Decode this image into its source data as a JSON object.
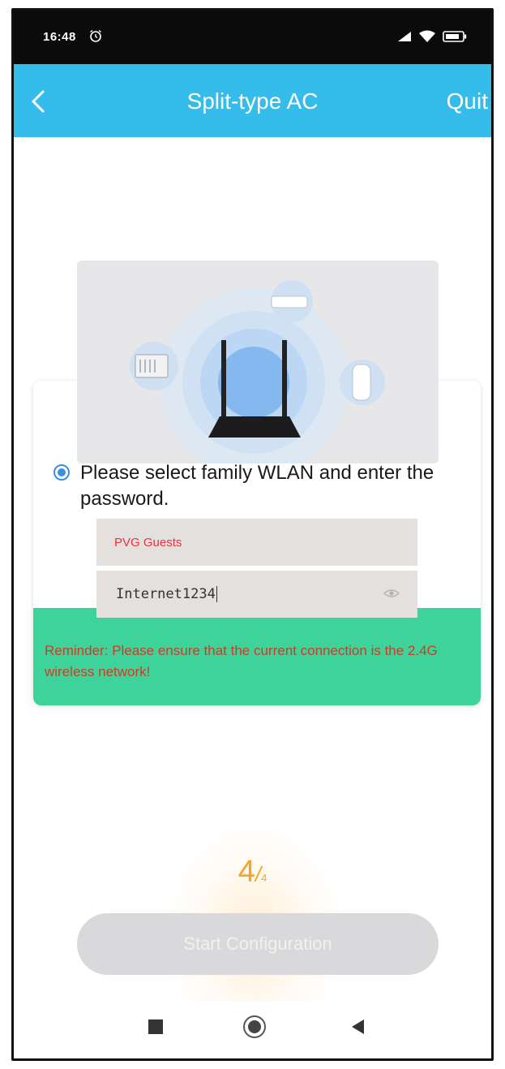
{
  "status_bar": {
    "time": "16:48",
    "icons": [
      "alarm-icon",
      "signal-icon",
      "wifi-icon",
      "battery-icon"
    ]
  },
  "header": {
    "back_icon": "chevron-left-icon",
    "title": "Split-type AC",
    "quit_label": "Quit",
    "background_color": "#35bcea"
  },
  "illustration": {
    "icons": [
      "router-icon",
      "window-ac-icon",
      "split-ac-icon",
      "portable-ac-icon"
    ]
  },
  "instruction": {
    "text": "Please select family WLAN and enter the password."
  },
  "wifi_network": {
    "value": "PVG Guests"
  },
  "password": {
    "value": "Internet1234",
    "toggle_icon": "eye-icon"
  },
  "reminder": {
    "text": "Reminder: Please ensure that the current connection is the 2.4G wireless network!",
    "background_color": "#3fd39c",
    "text_color": "#cf3b22"
  },
  "step": {
    "current": "4",
    "separator": "/",
    "total": "4"
  },
  "start_button": {
    "label": "Start Configuration"
  },
  "nav_bar": {
    "icons": [
      "recent-apps-icon",
      "home-icon",
      "back-triangle-icon"
    ]
  }
}
